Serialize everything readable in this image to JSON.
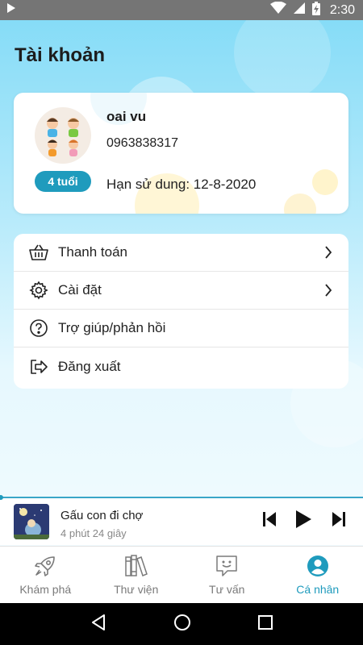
{
  "status_bar": {
    "time": "2:30",
    "icons": [
      "play-icon",
      "wifi-icon",
      "signal-icon",
      "battery-charging-icon"
    ]
  },
  "page": {
    "title": "Tài khoản"
  },
  "profile": {
    "name": "oai vu",
    "phone": "0963838317",
    "expiry": "Hạn sử dung: 12-8-2020",
    "age_badge": "4 tuổi"
  },
  "menu": {
    "items": [
      {
        "label": "Thanh toán",
        "icon": "basket-icon",
        "has_chevron": true
      },
      {
        "label": "Cài đặt",
        "icon": "gear-icon",
        "has_chevron": true
      },
      {
        "label": "Trợ giúp/phản hồi",
        "icon": "help-icon",
        "has_chevron": false
      },
      {
        "label": "Đăng xuất",
        "icon": "logout-icon",
        "has_chevron": false
      }
    ]
  },
  "player": {
    "title": "Gấu con đi chợ",
    "duration": "4 phút 24 giây",
    "controls": [
      "skip-previous-icon",
      "play-icon",
      "skip-next-icon"
    ],
    "progress": 0.0
  },
  "tabs": {
    "items": [
      {
        "label": "Khám phá",
        "icon": "rocket-icon",
        "active": false
      },
      {
        "label": "Thư viện",
        "icon": "books-icon",
        "active": false
      },
      {
        "label": "Tư vấn",
        "icon": "chat-icon",
        "active": false
      },
      {
        "label": "Cá nhân",
        "icon": "person-icon",
        "active": true
      }
    ]
  },
  "colors": {
    "accent": "#1f9bbd",
    "background_top": "#86dcf7",
    "inactive_tab": "#7a7a7a"
  }
}
